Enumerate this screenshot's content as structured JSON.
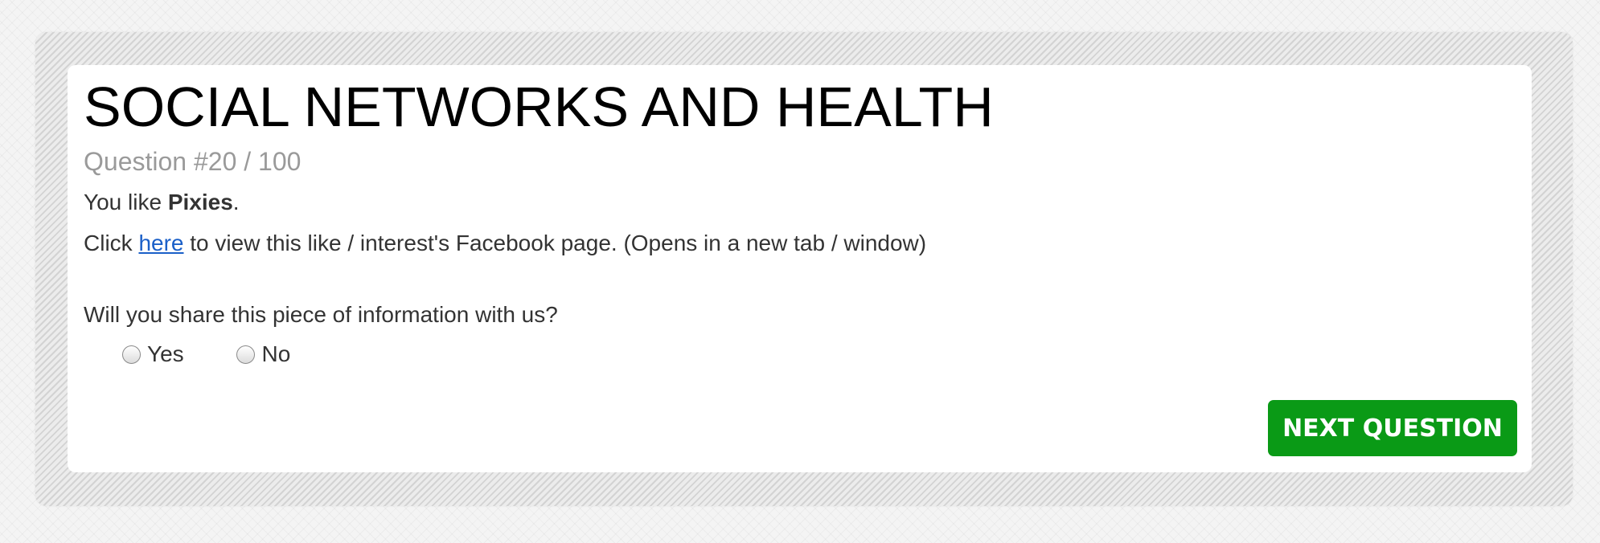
{
  "survey": {
    "title": "SOCIAL NETWORKS AND HEALTH",
    "question_counter": "Question #20 / 100",
    "like_prefix": "You like ",
    "like_name": "Pixies",
    "like_suffix": ".",
    "click_prefix": "Click ",
    "click_link": "here",
    "click_suffix": " to view this like / interest's Facebook page. (Opens in a new tab / window)",
    "share_question": "Will you share this piece of information with us?",
    "options": [
      {
        "label": "Yes"
      },
      {
        "label": "No"
      }
    ],
    "next_button_label": "NEXT QUESTION"
  },
  "colors": {
    "accent_button": "#0a9a16",
    "link": "#1a5fc8",
    "muted_text": "#9a9a9a",
    "body_text": "#333333"
  }
}
